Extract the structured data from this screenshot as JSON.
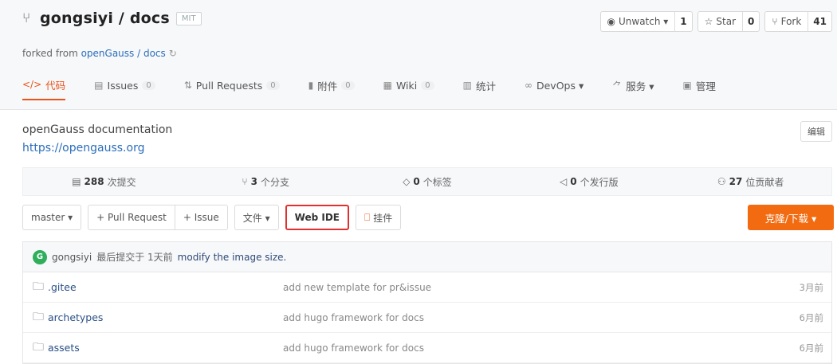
{
  "repo": {
    "title": "gongsiyi / docs",
    "license": "MIT",
    "forked_prefix": "forked from ",
    "forked_source": "openGauss / docs"
  },
  "actions": [
    {
      "label": "Unwatch ▾",
      "count": "1",
      "icon": "eye-icon"
    },
    {
      "label": "Star",
      "count": "0",
      "icon": "star-icon"
    },
    {
      "label": "Fork",
      "count": "41",
      "icon": "fork-icon"
    }
  ],
  "nav": [
    {
      "label": "代码",
      "icon": "code-icon",
      "active": true
    },
    {
      "label": "Issues",
      "badge": "0",
      "icon": "issues-icon"
    },
    {
      "label": "Pull Requests",
      "badge": "0",
      "icon": "pull-request-icon"
    },
    {
      "label": "附件",
      "badge": "0",
      "icon": "attachment-icon"
    },
    {
      "label": "Wiki",
      "badge": "0",
      "icon": "wiki-icon"
    },
    {
      "label": "统计",
      "icon": "stats-icon"
    },
    {
      "label": "DevOps ▾",
      "icon": "devops-icon"
    },
    {
      "label": "服务 ▾",
      "icon": "service-icon"
    },
    {
      "label": "管理",
      "icon": "manage-icon"
    }
  ],
  "about": {
    "description": "openGauss documentation",
    "homepage": "https://opengauss.org",
    "edit_label": "编辑"
  },
  "stats": [
    {
      "num": "288",
      "label": "次提交"
    },
    {
      "num": "3",
      "label": "个分支"
    },
    {
      "num": "0",
      "label": "个标签"
    },
    {
      "num": "0",
      "label": "个发行版"
    },
    {
      "num": "27",
      "label": "位贡献者"
    }
  ],
  "toolbar": {
    "branch": "master ▾",
    "pull_request": "+ Pull Request",
    "issue": "+ Issue",
    "file": "文件 ▾",
    "web_ide": "Web IDE",
    "widget": "挂件",
    "clone": "克隆/下载 ▾"
  },
  "commit": {
    "avatar_letter": "G",
    "author": "gongsiyi",
    "meta": "最后提交于 1天前",
    "message": "modify the image size."
  },
  "files": [
    {
      "name": ".gitee",
      "message": "add new template for pr&issue",
      "time": "3月前"
    },
    {
      "name": "archetypes",
      "message": "add hugo framework for docs",
      "time": "6月前"
    },
    {
      "name": "assets",
      "message": "add hugo framework for docs",
      "time": "6月前"
    }
  ],
  "colors": {
    "accent": "#e8541a",
    "clone_bg": "#f26b10",
    "link": "#2a6ebb",
    "highlight_border": "#e03030"
  }
}
